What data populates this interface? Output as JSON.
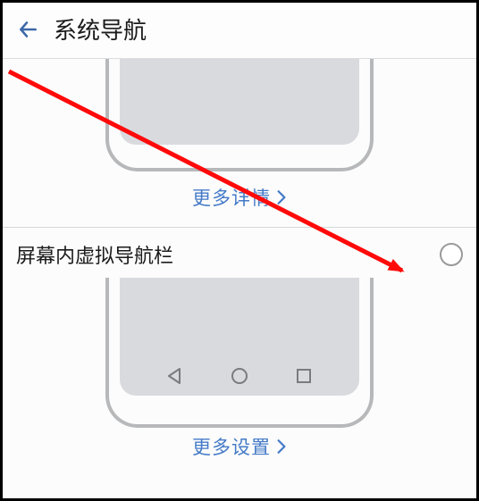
{
  "header": {
    "title": "系统导航"
  },
  "option1": {
    "more_label": "更多详情"
  },
  "option2": {
    "label": "屏幕内虚拟导航栏",
    "more_label": "更多设置"
  },
  "colors": {
    "link": "#447ac7",
    "arrow": "#ff0a0a",
    "outline": "#b7b8ba"
  },
  "icons": {
    "back": "back-arrow-icon",
    "nav_back": "triangle-back-icon",
    "nav_home": "circle-home-icon",
    "nav_recent": "square-recent-icon",
    "chevron": "chevron-right-icon"
  }
}
